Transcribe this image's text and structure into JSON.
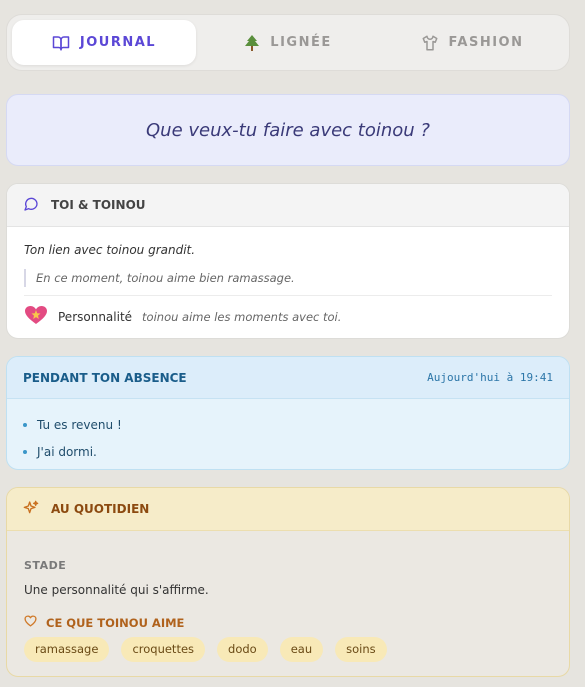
{
  "tabs": [
    {
      "label": "JOURNAL",
      "icon": "book-icon",
      "active": true
    },
    {
      "label": "LIGNÉE",
      "icon": "tree-icon",
      "active": false
    },
    {
      "label": "FASHION",
      "icon": "shirt-icon",
      "active": false
    }
  ],
  "prompt": "Que veux-tu faire avec toinou ?",
  "toi": {
    "title": "TOI & TOINOU",
    "icon": "chat-bubble-icon",
    "lien": "Ton lien avec toinou grandit.",
    "quote": "En ce moment, toinou aime bien ramassage.",
    "personality_label": "Personnalité",
    "personality_text": "toinou aime les moments avec toi.",
    "personality_icon": "heart-sparkle-icon"
  },
  "absence": {
    "title": "PENDANT TON ABSENCE",
    "time": "Aujourd'hui à 19:41",
    "items": [
      "Tu es revenu !",
      "J'ai dormi."
    ]
  },
  "quotidien": {
    "title": "AU QUOTIDIEN",
    "icon": "sparkles-icon",
    "stade_label": "STADE",
    "stade_text": "Une personnalité qui s'affirme.",
    "aime_title": "CE QUE TOINOU AIME",
    "aime_icon": "heart-outline-icon",
    "chips": [
      "ramassage",
      "croquettes",
      "dodo",
      "eau",
      "soins"
    ]
  },
  "colors": {
    "accent": "#5b47d6",
    "prompt_text": "#3a3a78",
    "absence_title": "#1a5d8a",
    "quotidien_title": "#8c4a10",
    "aime_title": "#b0621c"
  }
}
